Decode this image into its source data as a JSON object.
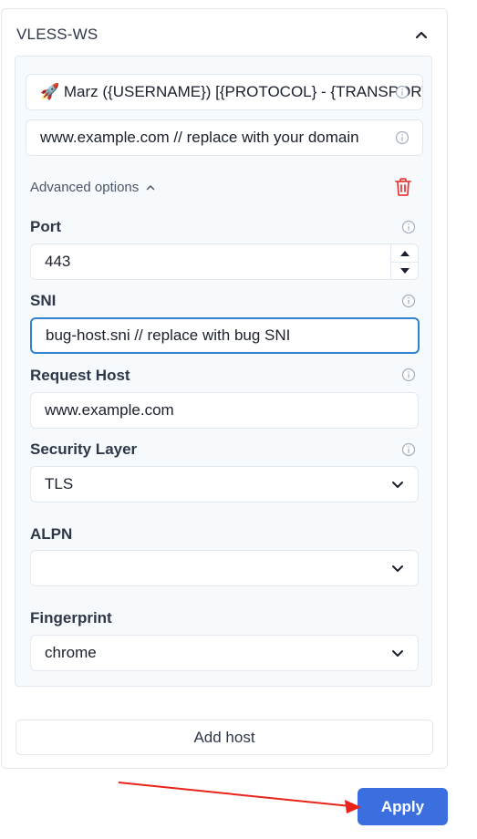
{
  "section": {
    "title": "VLESS-WS"
  },
  "host": {
    "remark_value": "🚀 Marz ({USERNAME}) [{PROTOCOL} - {TRANSPORT}]",
    "address_value": "www.example.com // replace with your domain",
    "advanced_label": "Advanced options",
    "port": {
      "label": "Port",
      "value": "443"
    },
    "sni": {
      "label": "SNI",
      "value": "bug-host.sni // replace with bug SNI"
    },
    "request_host": {
      "label": "Request Host",
      "value": "www.example.com"
    },
    "security_layer": {
      "label": "Security Layer",
      "value": "TLS"
    },
    "alpn": {
      "label": "ALPN",
      "value": ""
    },
    "fingerprint": {
      "label": "Fingerprint",
      "value": "chrome"
    }
  },
  "actions": {
    "add_host_label": "Add host",
    "apply_label": "Apply"
  },
  "colors": {
    "primary": "#3b6fe0",
    "danger": "#e53e3e",
    "focus_border": "#3182ce",
    "annotation_arrow": "#e8231a"
  },
  "icons": [
    "chevron-up-icon",
    "info-icon",
    "trash-icon",
    "chevron-down-icon",
    "stepper-up-icon",
    "stepper-down-icon"
  ]
}
